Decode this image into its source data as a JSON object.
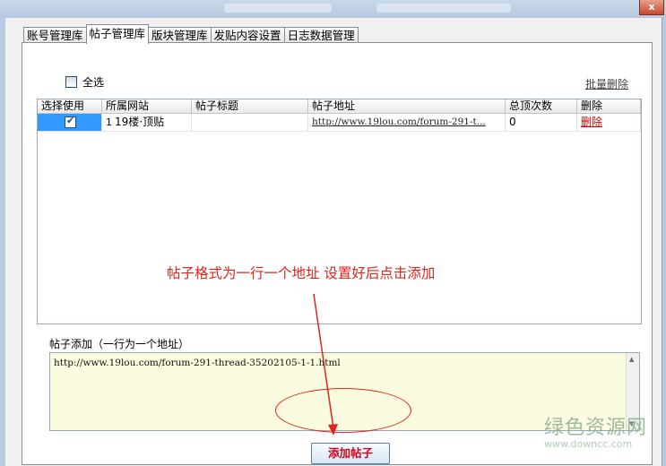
{
  "window": {
    "close_label": "x"
  },
  "tabs": [
    {
      "label": "账号管理库",
      "active": false
    },
    {
      "label": "帖子管理库",
      "active": true
    },
    {
      "label": "版块管理库",
      "active": false
    },
    {
      "label": "发贴内容设置",
      "active": false
    },
    {
      "label": "日志数据管理",
      "active": false
    }
  ],
  "toolbar": {
    "select_all_label": "全选",
    "batch_delete_label": "批量删除"
  },
  "table": {
    "columns": [
      "选择使用",
      "所属网站",
      "帖子标题",
      "帖子地址",
      "总顶次数",
      "删除"
    ],
    "rows": [
      {
        "checked": true,
        "num": "1",
        "site": "19楼·顶贴",
        "title": "",
        "url": "http://www.19lou.com/forum-291-t...",
        "count": "0",
        "delete": "删除"
      }
    ]
  },
  "annotation": {
    "text": "帖子格式为一行一个地址  设置好后点击添加",
    "color": "#e0251b"
  },
  "add_section": {
    "label": "帖子添加（一行为一个地址）",
    "textarea_value": "http://www.19lou.com/forum-291-thread-35202105-1-1.html",
    "button_label": "添加帖子"
  },
  "watermark": {
    "title": "绿色资源网",
    "url": "www.downcc.com"
  }
}
